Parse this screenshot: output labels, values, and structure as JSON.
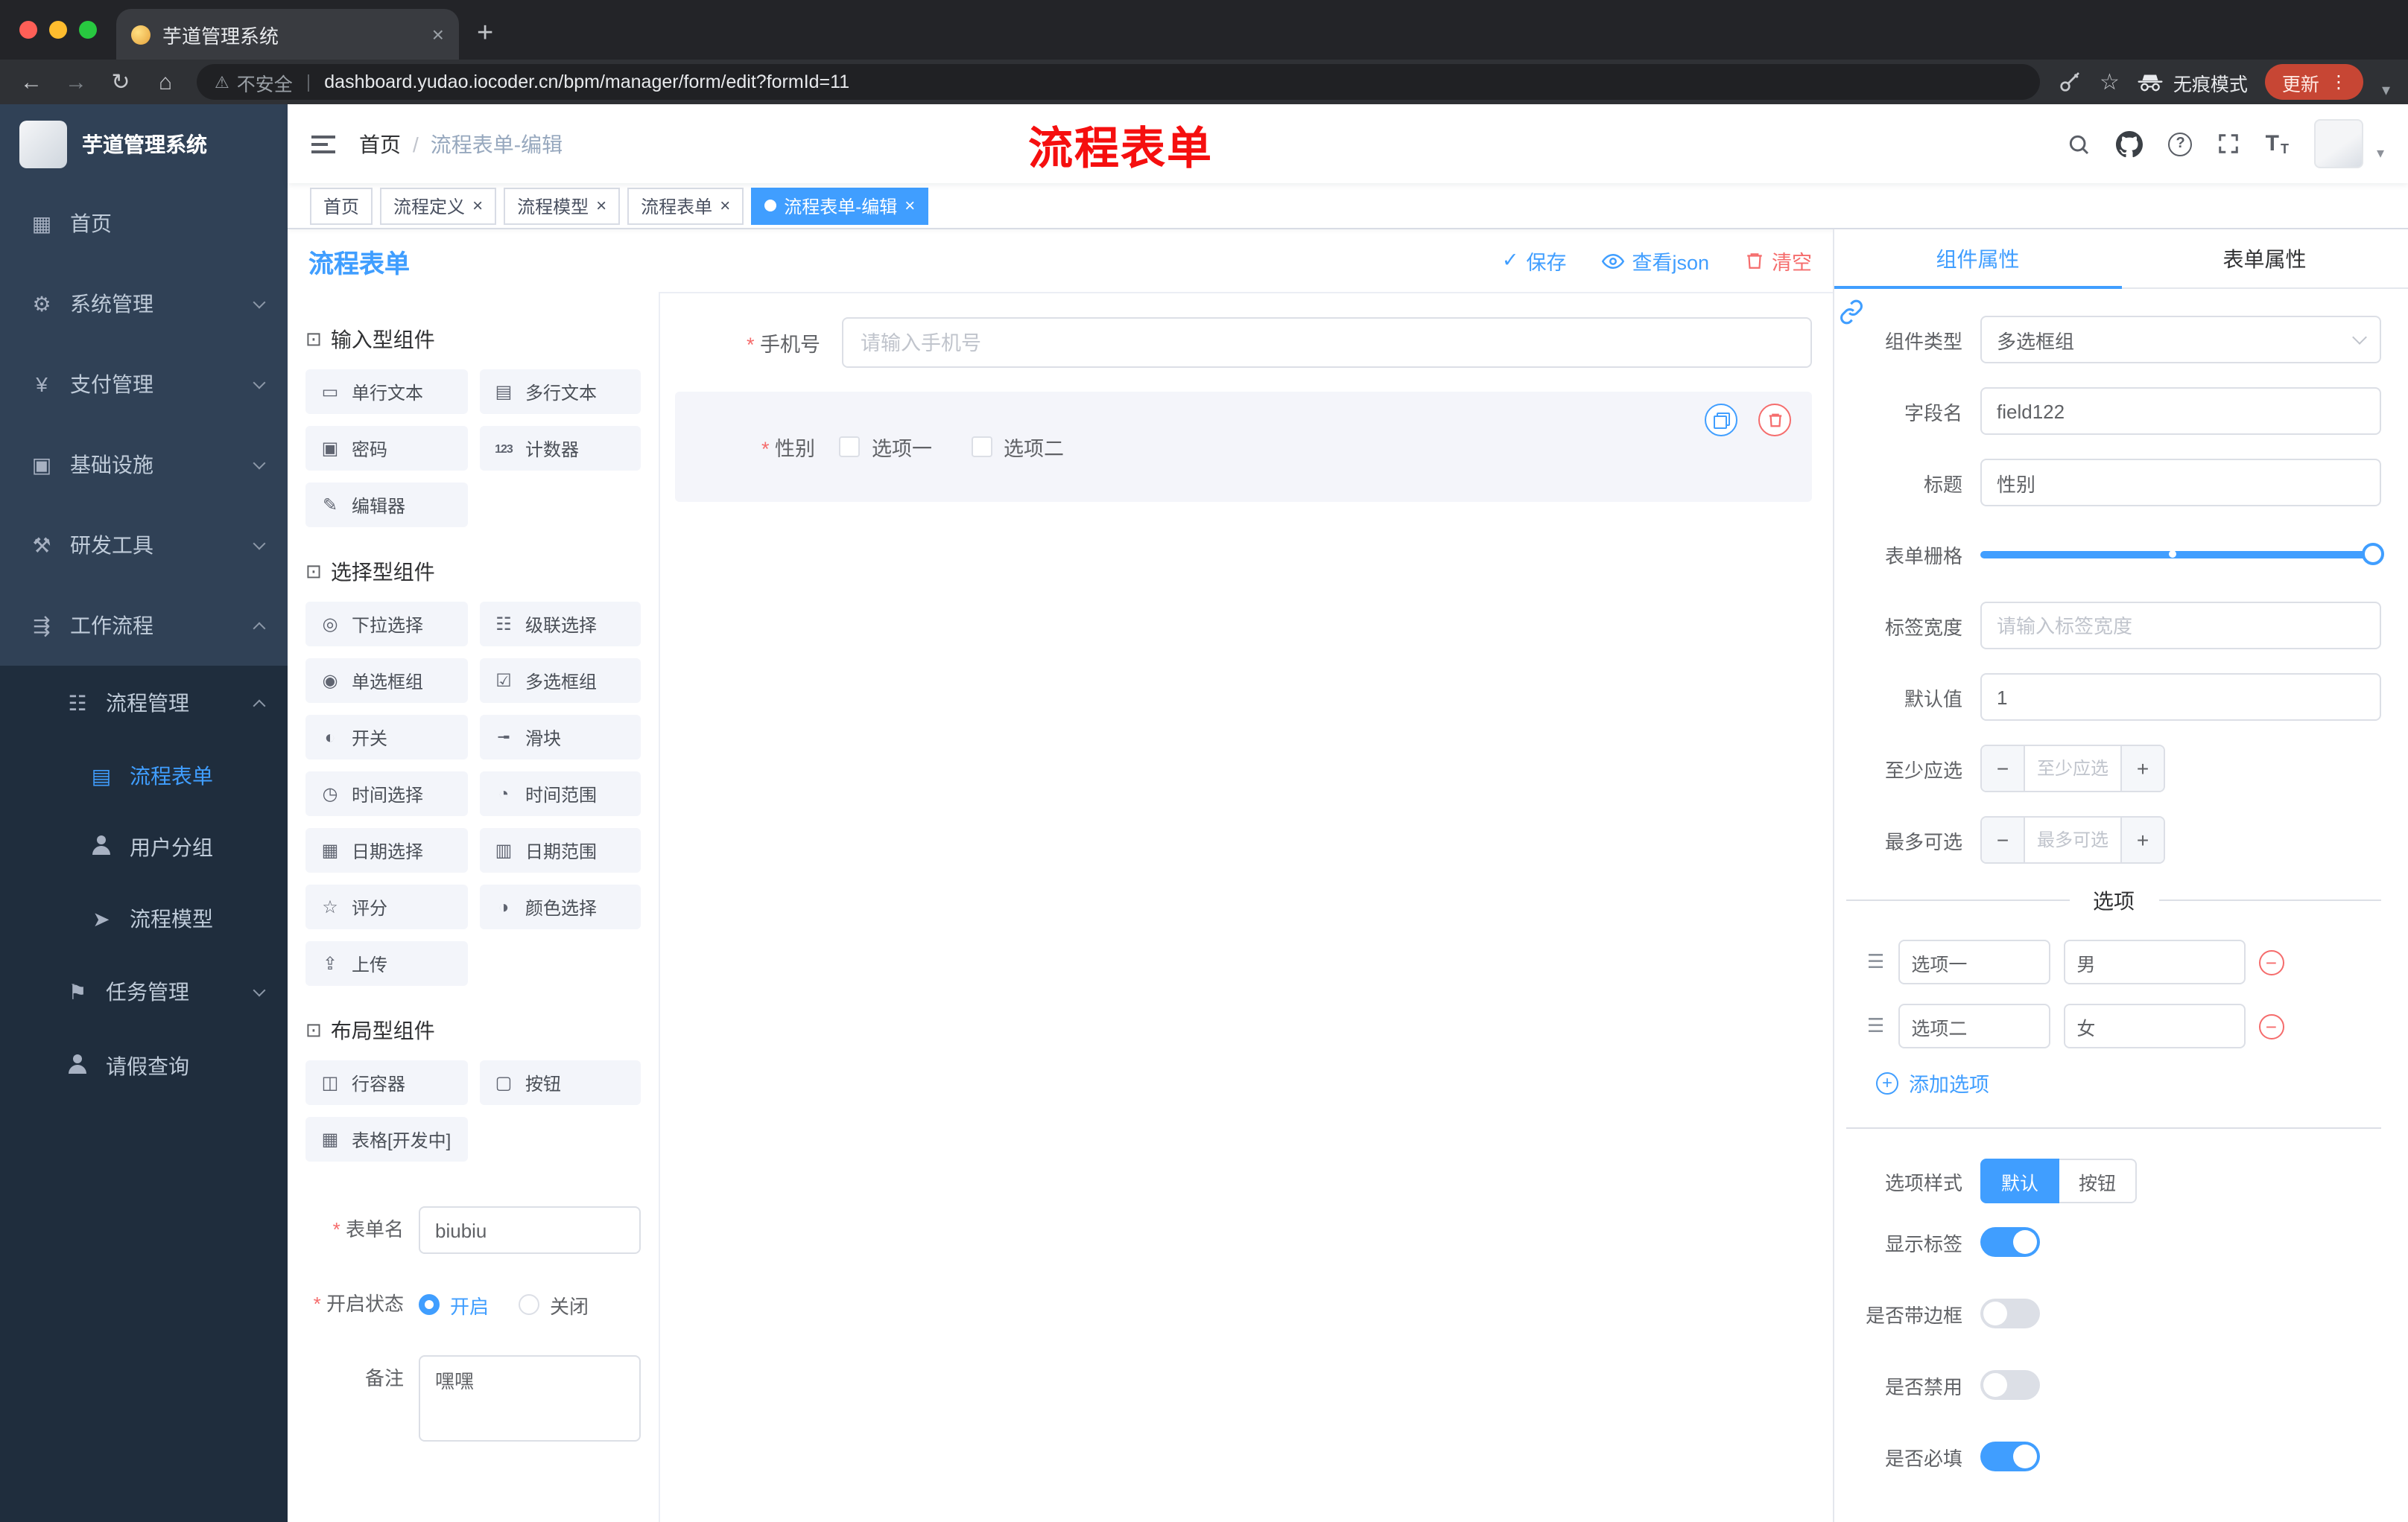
{
  "colors": {
    "accent": "#409eff",
    "danger": "#f56c6c",
    "sidebar_bg": "#304156",
    "sidebar_sub_bg": "#1f2d3d",
    "annotation_red": "#f50f0f",
    "update_pill": "#c74634"
  },
  "browser": {
    "tab_title": "芋道管理系统",
    "security_label": "不安全",
    "url": "dashboard.yudao.iocoder.cn/bpm/manager/form/edit?formId=11",
    "incognito_label": "无痕模式",
    "update_label": "更新"
  },
  "sidebar": {
    "title": "芋道管理系统",
    "items": [
      {
        "label": "首页",
        "icon": "▦"
      },
      {
        "label": "系统管理",
        "icon": "⚙"
      },
      {
        "label": "支付管理",
        "icon": "¥"
      },
      {
        "label": "基础设施",
        "icon": "▣"
      },
      {
        "label": "研发工具",
        "icon": "⚒"
      },
      {
        "label": "工作流程",
        "icon": "⇶"
      },
      {
        "label": "流程管理",
        "icon": "☷"
      },
      {
        "label": "流程表单",
        "icon": "▤"
      },
      {
        "label": "用户分组",
        "icon": ""
      },
      {
        "label": "流程模型",
        "icon": "➤"
      },
      {
        "label": "任务管理",
        "icon": "⚑"
      },
      {
        "label": "请假查询",
        "icon": ""
      }
    ]
  },
  "header": {
    "breadcrumb_root": "首页",
    "breadcrumb_current": "流程表单-编辑",
    "annotation": "流程表单"
  },
  "tags": [
    {
      "label": "首页"
    },
    {
      "label": "流程定义"
    },
    {
      "label": "流程模型"
    },
    {
      "label": "流程表单"
    },
    {
      "label": "流程表单-编辑"
    }
  ],
  "designer": {
    "title": "流程表单",
    "save": "保存",
    "view_json": "查看json",
    "clear": "清空",
    "groups": [
      {
        "title": "输入型组件",
        "items": [
          {
            "label": "单行文本",
            "icon": "▭"
          },
          {
            "label": "多行文本",
            "icon": "▤"
          },
          {
            "label": "密码",
            "icon": "▣"
          },
          {
            "label": "计数器",
            "icon": "123"
          },
          {
            "label": "编辑器",
            "icon": "✎"
          }
        ]
      },
      {
        "title": "选择型组件",
        "items": [
          {
            "label": "下拉选择",
            "icon": "◎"
          },
          {
            "label": "级联选择",
            "icon": "☷"
          },
          {
            "label": "单选框组",
            "icon": "◉"
          },
          {
            "label": "多选框组",
            "icon": "☑"
          },
          {
            "label": "开关",
            "icon": "◐"
          },
          {
            "label": "滑块",
            "icon": "╼"
          },
          {
            "label": "时间选择",
            "icon": "◷"
          },
          {
            "label": "时间范围",
            "icon": "◔"
          },
          {
            "label": "日期选择",
            "icon": "▦"
          },
          {
            "label": "日期范围",
            "icon": "▥"
          },
          {
            "label": "评分",
            "icon": "☆"
          },
          {
            "label": "颜色选择",
            "icon": "◑"
          },
          {
            "label": "上传",
            "icon": "⇪"
          }
        ]
      },
      {
        "title": "布局型组件",
        "items": [
          {
            "label": "行容器",
            "icon": "◫"
          },
          {
            "label": "按钮",
            "icon": "▢"
          },
          {
            "label": "表格[开发中]",
            "icon": "▦"
          }
        ]
      }
    ],
    "meta": {
      "name_label": "表单名",
      "name_value": "biubiu",
      "status_label": "开启状态",
      "status_on": "开启",
      "status_off": "关闭",
      "remark_label": "备注",
      "remark_value": "嘿嘿"
    },
    "canvas": {
      "phone_label": "手机号",
      "phone_placeholder": "请输入手机号",
      "gender_label": "性别",
      "gender_opt1": "选项一",
      "gender_opt2": "选项二"
    }
  },
  "props": {
    "tab_component": "组件属性",
    "tab_form": "表单属性",
    "rows": {
      "type_label": "组件类型",
      "type_value": "多选框组",
      "field_label": "字段名",
      "field_value": "field122",
      "title_label": "标题",
      "title_value": "性别",
      "grid_label": "表单栅格",
      "width_label": "标签宽度",
      "width_placeholder": "请输入标签宽度",
      "default_label": "默认值",
      "default_value": "1",
      "min_label": "至少应选",
      "min_placeholder": "至少应选",
      "max_label": "最多可选",
      "max_placeholder": "最多可选"
    },
    "options_title": "选项",
    "options": [
      {
        "label": "选项一",
        "value": "男"
      },
      {
        "label": "选项二",
        "value": "女"
      }
    ],
    "add_option": "添加选项",
    "style_label": "选项样式",
    "style_default": "默认",
    "style_button": "按钮",
    "switches": [
      {
        "label": "显示标签",
        "on": true
      },
      {
        "label": "是否带边框",
        "on": false
      },
      {
        "label": "是否禁用",
        "on": false
      },
      {
        "label": "是否必填",
        "on": true
      }
    ]
  }
}
